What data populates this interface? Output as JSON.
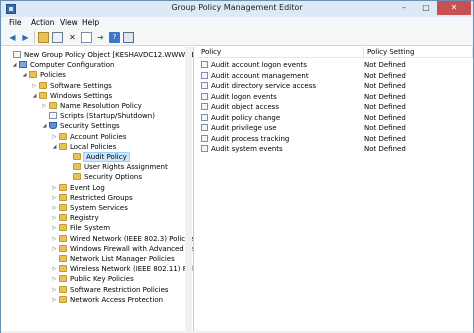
{
  "window": {
    "title": "Group Policy Management Editor",
    "minimize": "–",
    "maximize": "□",
    "close": "✕"
  },
  "menu": [
    "File",
    "Action",
    "View",
    "Help"
  ],
  "toolbar": [
    "back-icon",
    "forward-icon",
    "up-folder-icon",
    "show-hide-tree-icon",
    "delete-icon",
    "properties-icon",
    "export-icon",
    "help-icon",
    "console-icon"
  ],
  "tree": [
    {
      "label": "New Group Policy Object [KESHAVDC12.WWW.ABOUT.",
      "icon": "doc",
      "level": 0,
      "expander": ""
    },
    {
      "label": "Computer Configuration",
      "icon": "comp",
      "level": 1,
      "expander": "◢"
    },
    {
      "label": "Policies",
      "icon": "folder",
      "level": 2,
      "expander": "◢"
    },
    {
      "label": "Software Settings",
      "icon": "folder",
      "level": 3,
      "expander": "▷"
    },
    {
      "label": "Windows Settings",
      "icon": "folder",
      "level": 3,
      "expander": "◢"
    },
    {
      "label": "Name Resolution Policy",
      "icon": "folder",
      "level": 4,
      "expander": "▷"
    },
    {
      "label": "Scripts (Startup/Shutdown)",
      "icon": "doc",
      "level": 4,
      "expander": ""
    },
    {
      "label": "Security Settings",
      "icon": "shield",
      "level": 4,
      "expander": "◢"
    },
    {
      "label": "Account Policies",
      "icon": "folder",
      "level": 5,
      "expander": "▷"
    },
    {
      "label": "Local Policies",
      "icon": "folder",
      "level": 5,
      "expander": "◢"
    },
    {
      "label": "Audit Policy",
      "icon": "folder",
      "level": 6,
      "expander": "",
      "selected": true
    },
    {
      "label": "User Rights Assignment",
      "icon": "folder",
      "level": 6,
      "expander": ""
    },
    {
      "label": "Security Options",
      "icon": "folder",
      "level": 6,
      "expander": ""
    },
    {
      "label": "Event Log",
      "icon": "folder",
      "level": 5,
      "expander": "▷"
    },
    {
      "label": "Restricted Groups",
      "icon": "folder",
      "level": 5,
      "expander": "▷"
    },
    {
      "label": "System Services",
      "icon": "folder",
      "level": 5,
      "expander": "▷"
    },
    {
      "label": "Registry",
      "icon": "folder",
      "level": 5,
      "expander": "▷"
    },
    {
      "label": "File System",
      "icon": "folder",
      "level": 5,
      "expander": "▷"
    },
    {
      "label": "Wired Network (IEEE 802.3) Policies",
      "icon": "folder",
      "level": 5,
      "expander": "▷"
    },
    {
      "label": "Windows Firewall with Advanced Secu",
      "icon": "folder",
      "level": 5,
      "expander": "▷"
    },
    {
      "label": "Network List Manager Policies",
      "icon": "folder",
      "level": 5,
      "expander": ""
    },
    {
      "label": "Wireless Network (IEEE 802.11) Policie",
      "icon": "folder",
      "level": 5,
      "expander": "▷"
    },
    {
      "label": "Public Key Policies",
      "icon": "folder",
      "level": 5,
      "expander": "▷"
    },
    {
      "label": "Software Restriction Policies",
      "icon": "folder",
      "level": 5,
      "expander": "▷"
    },
    {
      "label": "Network Access Protection",
      "icon": "folder",
      "level": 5,
      "expander": "▷"
    }
  ],
  "list": {
    "columns": [
      "Policy",
      "Policy Setting"
    ],
    "rows": [
      {
        "policy": "Audit account logon events",
        "setting": "Not Defined"
      },
      {
        "policy": "Audit account management",
        "setting": "Not Defined"
      },
      {
        "policy": "Audit directory service access",
        "setting": "Not Defined"
      },
      {
        "policy": "Audit logon events",
        "setting": "Not Defined"
      },
      {
        "policy": "Audit object access",
        "setting": "Not Defined"
      },
      {
        "policy": "Audit policy change",
        "setting": "Not Defined"
      },
      {
        "policy": "Audit privilege use",
        "setting": "Not Defined"
      },
      {
        "policy": "Audit process tracking",
        "setting": "Not Defined"
      },
      {
        "policy": "Audit system events",
        "setting": "Not Defined"
      }
    ]
  },
  "colors": {
    "title_bar": "#dde9f5",
    "selection": "#cce8ff",
    "close_button": "#c75050"
  }
}
